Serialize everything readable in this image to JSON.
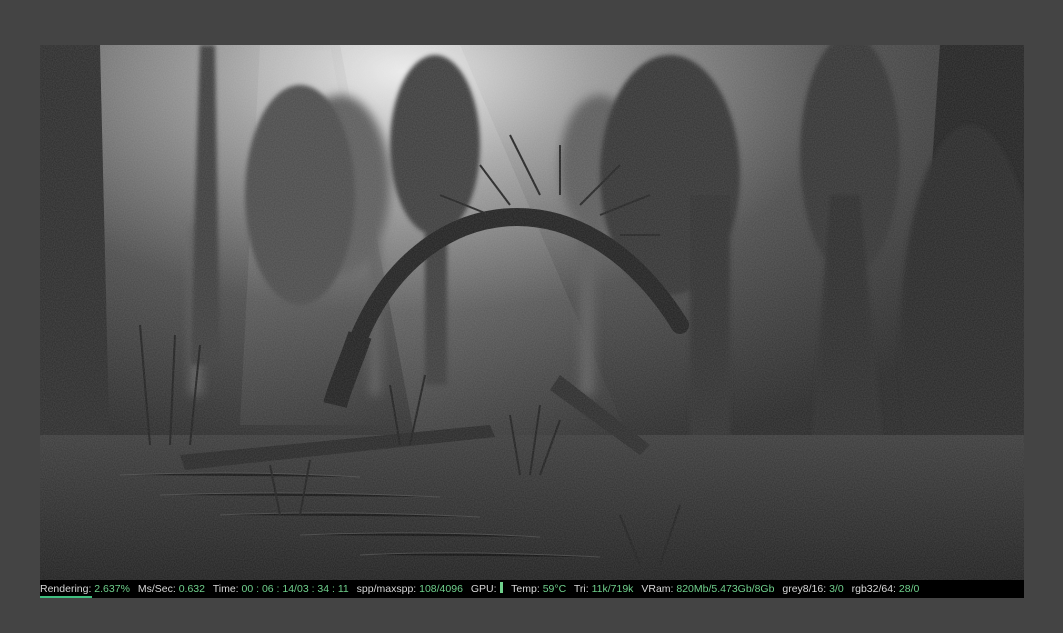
{
  "render": {
    "scene": "foggy swamp with bent tree",
    "status": {
      "rendering_label": "Rendering:",
      "rendering_value": "2.637%",
      "progress_fraction": 0.02637,
      "ms_label": "Ms/Sec:",
      "ms_value": "0.632",
      "time_label": "Time:",
      "time_value": "00 : 06 : 14/03 : 34 : 11",
      "spp_label": "spp/maxspp:",
      "spp_value": "108/4096",
      "gpu_label": "GPU:",
      "gpu_fraction": 1.0,
      "temp_label": "Temp:",
      "temp_value": "59°C",
      "tri_label": "Tri:",
      "tri_value": "11k/719k",
      "vram_label": "VRam:",
      "vram_value": "820Mb/5.473Gb/8Gb",
      "grey_label": "grey8/16:",
      "grey_value": "3/0",
      "rgb_label": "rgb32/64:",
      "rgb_value": "28/0"
    }
  },
  "colors": {
    "background": "#444444",
    "status_bg": "#000000",
    "value_green": "#6fd08c",
    "label_text": "#d8d8d8"
  }
}
